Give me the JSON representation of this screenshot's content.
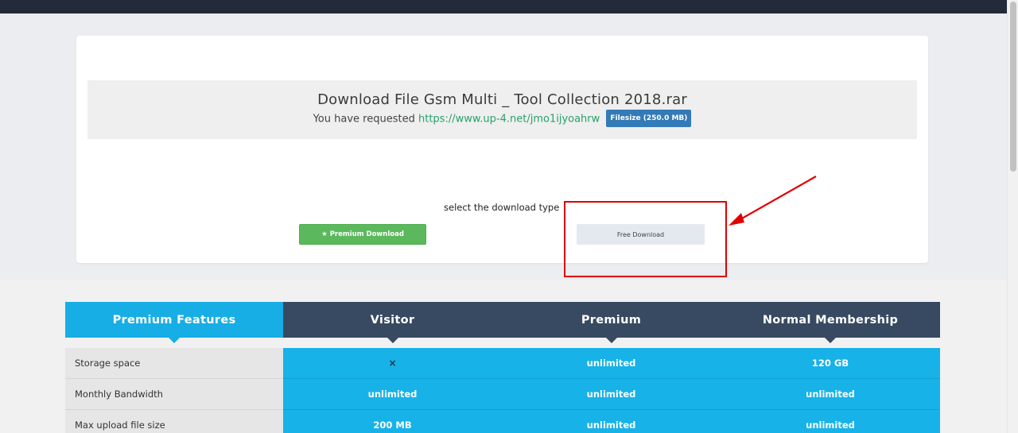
{
  "file": {
    "title": "Download File Gsm Multi _ Tool Collection 2018.rar",
    "requested_prefix": "You have requested",
    "link": "https://www.up-4.net/jmo1ijyoahrw",
    "filesize_label": "Filesize (250.0 MB)"
  },
  "download": {
    "select_label": "select the download type",
    "premium_label": "Premium Download",
    "premium_icon": "star-icon",
    "free_label": "Free Download"
  },
  "annotation": {
    "color": "#e00000"
  },
  "pricing": {
    "headers": [
      "Premium Features",
      "Visitor",
      "Premium",
      "Normal Membership"
    ],
    "rows": [
      {
        "label": "Storage space",
        "visitor": "×",
        "premium": "unlimited",
        "normal": "120 GB"
      },
      {
        "label": "Monthly Bandwidth",
        "visitor": "unlimited",
        "premium": "unlimited",
        "normal": "unlimited"
      },
      {
        "label": "Max upload file size",
        "visitor": "200 MB",
        "premium": "unlimited",
        "normal": "unlimited"
      }
    ]
  },
  "colors": {
    "topbar": "#232b3a",
    "accent_blue": "#17aee6",
    "header_dark": "#384a62",
    "premium_green": "#5cb85c",
    "link_green": "#28a06e",
    "badge_blue": "#337ab7"
  }
}
